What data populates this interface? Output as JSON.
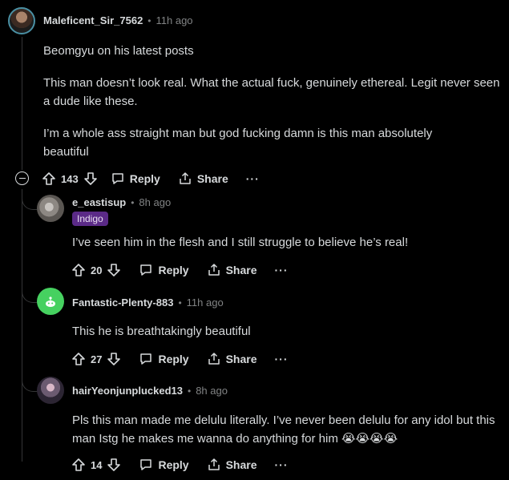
{
  "comments": [
    {
      "username": "Maleficent_Sir_7562",
      "separator": "•",
      "time": "11h ago",
      "paragraphs": [
        "Beomgyu on his latest posts",
        "This man doesn’t look real. What the actual fuck, genuinely ethereal. Legit never seen a dude like these.",
        "I’m a whole ass straight man but god fucking damn is this man absolutely beautiful"
      ],
      "votes": "143",
      "reply_label": "Reply",
      "share_label": "Share",
      "more_label": "···"
    },
    {
      "username": "e_eastisup",
      "separator": "•",
      "time": "8h ago",
      "flair": "Indigo",
      "paragraphs": [
        "I’ve seen him in the flesh and I still struggle to believe he’s real!"
      ],
      "votes": "20",
      "reply_label": "Reply",
      "share_label": "Share",
      "more_label": "···"
    },
    {
      "username": "Fantastic-Plenty-883",
      "separator": "•",
      "time": "11h ago",
      "paragraphs": [
        "This he is breathtakingly beautiful"
      ],
      "votes": "27",
      "reply_label": "Reply",
      "share_label": "Share",
      "more_label": "···"
    },
    {
      "username": "hairYeonjunplucked13",
      "separator": "•",
      "time": "8h ago",
      "paragraphs": [
        "Pls this man made me delulu literally. I’ve never been delulu for any idol but this man Istg he makes me wanna do anything for him 😭😭😭😭"
      ],
      "votes": "14",
      "reply_label": "Reply",
      "share_label": "Share",
      "more_label": "···"
    }
  ],
  "collapse_label": "−",
  "colors": {
    "background": "#000000",
    "text": "#d7dadc",
    "muted": "#818384",
    "flair_bg": "#5b2a87",
    "thread_line": "#343536"
  }
}
